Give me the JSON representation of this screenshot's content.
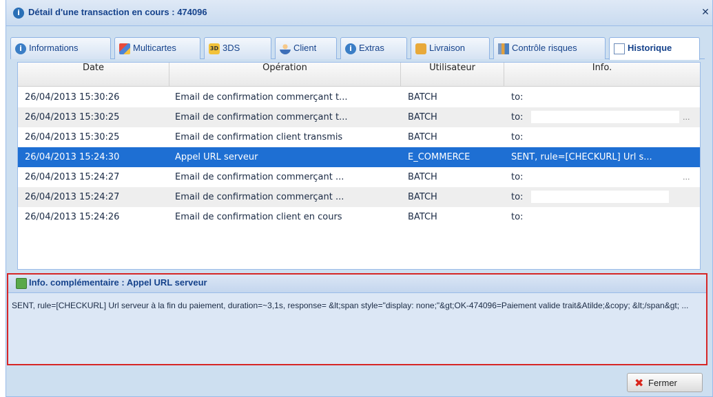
{
  "window": {
    "title": "Détail d'une transaction en cours : 474096",
    "close_icon": "close-icon"
  },
  "tabs": [
    {
      "label": "Informations",
      "icon": "info-icon",
      "active": false
    },
    {
      "label": "Multicartes",
      "icon": "cards-icon",
      "active": false
    },
    {
      "label": "3DS",
      "icon": "lock-3ds-icon",
      "active": false
    },
    {
      "label": "Client",
      "icon": "user-icon",
      "active": false
    },
    {
      "label": "Extras",
      "icon": "info-icon",
      "active": false
    },
    {
      "label": "Livraison",
      "icon": "box-icon",
      "active": false
    },
    {
      "label": "Contrôle risques",
      "icon": "risk-chart-icon",
      "active": false
    },
    {
      "label": "Historique",
      "icon": "history-icon",
      "active": true
    }
  ],
  "grid": {
    "columns": [
      "Date",
      "Opération",
      "Utilisateur",
      "Info."
    ],
    "rows": [
      {
        "date": "26/04/2013 15:30:26",
        "operation": "Email de confirmation commerçant t...",
        "user": "BATCH",
        "info": "to:"
      },
      {
        "date": "26/04/2013 15:30:25",
        "operation": "Email de confirmation commerçant t...",
        "user": "BATCH",
        "info": "to:"
      },
      {
        "date": "26/04/2013 15:30:25",
        "operation": "Email de confirmation client transmis",
        "user": "BATCH",
        "info": "to:"
      },
      {
        "date": "26/04/2013 15:24:30",
        "operation": "Appel URL serveur",
        "user": "E_COMMERCE",
        "info": "SENT, rule=[CHECKURL] Url s..."
      },
      {
        "date": "26/04/2013 15:24:27",
        "operation": "Email de confirmation commerçant ...",
        "user": "BATCH",
        "info": "to:"
      },
      {
        "date": "26/04/2013 15:24:27",
        "operation": "Email de confirmation commerçant ...",
        "user": "BATCH",
        "info": "to:"
      },
      {
        "date": "26/04/2013 15:24:26",
        "operation": "Email de confirmation client en cours",
        "user": "BATCH",
        "info": "to:"
      }
    ],
    "ellipsis": "..."
  },
  "info_panel": {
    "title": "Info. complémentaire : Appel URL serveur",
    "body": "SENT, rule=[CHECKURL] Url serveur à la fin du paiement, duration=~3,1s, response= &lt;span style=\"display: none;\"&gt;OK-474096=Paiement valide trait&Atilde;&copy; &lt;/span&gt; ..."
  },
  "footer": {
    "close_label": "Fermer"
  },
  "colors": {
    "selected_row": "#1e6fd3",
    "panel_border": "#d62525",
    "title_text": "#15428b"
  }
}
